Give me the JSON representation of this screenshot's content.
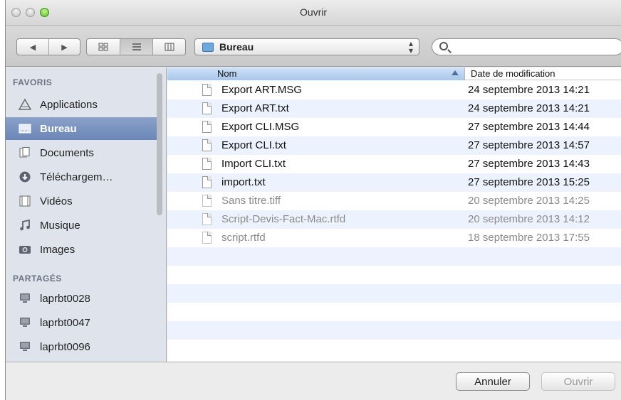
{
  "window": {
    "title": "Ouvrir"
  },
  "toolbar": {
    "location": "Bureau",
    "search_placeholder": ""
  },
  "sidebar": {
    "favoris_heading": "FAVORIS",
    "favoris": [
      {
        "label": "Applications",
        "icon": "applications-icon"
      },
      {
        "label": "Bureau",
        "icon": "desktop-icon",
        "selected": true
      },
      {
        "label": "Documents",
        "icon": "documents-icon"
      },
      {
        "label": "Téléchargem…",
        "icon": "downloads-icon"
      },
      {
        "label": "Vidéos",
        "icon": "movies-icon"
      },
      {
        "label": "Musique",
        "icon": "music-icon"
      },
      {
        "label": "Images",
        "icon": "pictures-icon"
      }
    ],
    "partages_heading": "PARTAGÉS",
    "partages": [
      {
        "label": "laprbt0028",
        "icon": "computer-icon"
      },
      {
        "label": "laprbt0047",
        "icon": "computer-icon"
      },
      {
        "label": "laprbt0096",
        "icon": "computer-icon"
      }
    ]
  },
  "file_list": {
    "columns": {
      "name": "Nom",
      "date": "Date de modification"
    },
    "rows": [
      {
        "name": "Export ART.MSG",
        "date": "24 septembre 2013 14:21",
        "enabled": true
      },
      {
        "name": "Export ART.txt",
        "date": "24 septembre 2013 14:21",
        "enabled": true
      },
      {
        "name": "Export CLI.MSG",
        "date": "27 septembre 2013 14:44",
        "enabled": true
      },
      {
        "name": "Export CLI.txt",
        "date": "27 septembre 2013 14:57",
        "enabled": true
      },
      {
        "name": "Import CLI.txt",
        "date": "27 septembre 2013 14:43",
        "enabled": true
      },
      {
        "name": "import.txt",
        "date": "27 septembre 2013 15:25",
        "enabled": true
      },
      {
        "name": "Sans titre.tiff",
        "date": "20 septembre 2013 14:25",
        "enabled": false
      },
      {
        "name": "Script-Devis-Fact-Mac.rtfd",
        "date": "20 septembre 2013 14:12",
        "enabled": false
      },
      {
        "name": "script.rtfd",
        "date": "18 septembre 2013 17:55",
        "enabled": false
      }
    ]
  },
  "buttons": {
    "cancel": "Annuler",
    "open": "Ouvrir"
  },
  "colors": {
    "selection": "#7391c0",
    "sidebar_bg": "#dfe4ec",
    "row_alt": "#edf3fe"
  }
}
